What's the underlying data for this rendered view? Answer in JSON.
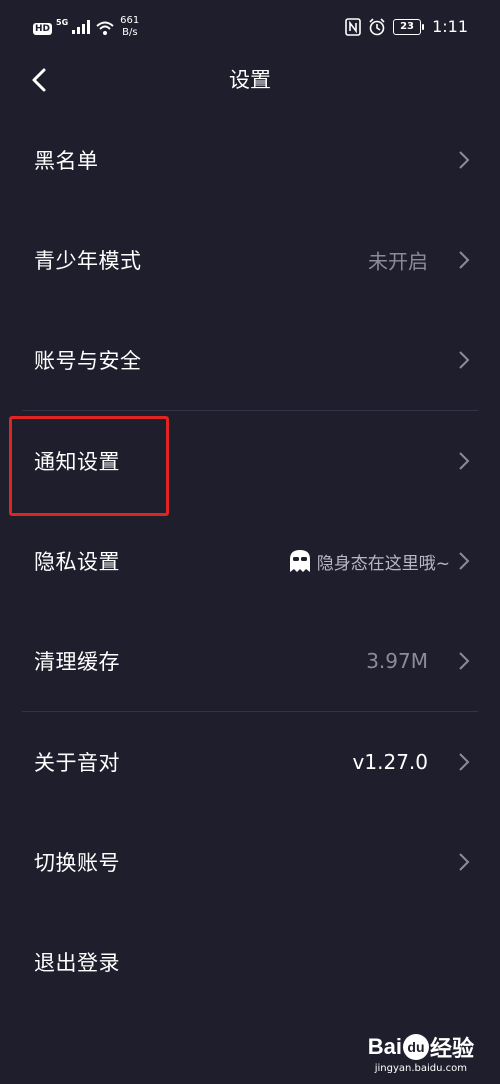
{
  "status_bar": {
    "hd": "HD",
    "network": "5G",
    "speed_value": "661",
    "speed_unit": "B/s",
    "battery": "23",
    "time": "1:11"
  },
  "header": {
    "title": "设置",
    "back_icon": "chevron-left-icon"
  },
  "settings": {
    "items": [
      {
        "label": "黑名单",
        "value": ""
      },
      {
        "label": "青少年模式",
        "value": "未开启"
      },
      {
        "label": "账号与安全",
        "value": ""
      },
      {
        "label": "通知设置",
        "value": ""
      },
      {
        "label": "隐私设置",
        "value": "隐身态在这里哦~"
      },
      {
        "label": "清理缓存",
        "value": "3.97M"
      },
      {
        "label": "关于音对",
        "value": "v1.27.0"
      },
      {
        "label": "切换账号",
        "value": ""
      },
      {
        "label": "退出登录",
        "value": ""
      }
    ]
  },
  "watermark": {
    "logo": "Bai",
    "logo_du": "du",
    "logo_suffix": "经验",
    "site": "jingyan.baidu.com"
  },
  "colors": {
    "background": "#1f1e2c",
    "secondary_text": "#8c8b99",
    "divider": "#34334a",
    "highlight": "#e02323"
  }
}
